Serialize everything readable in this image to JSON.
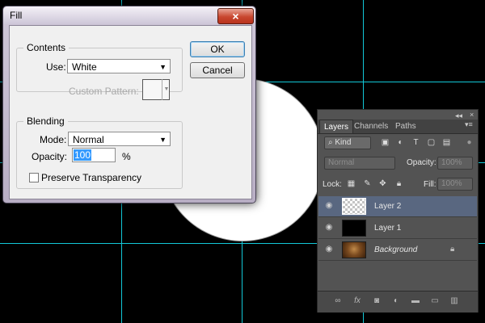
{
  "fill_dialog": {
    "title": "Fill",
    "close": "×",
    "contents_legend": "Contents",
    "use_label": "Use:",
    "use_value": "White",
    "custom_pattern_label": "Custom Pattern:",
    "blending_legend": "Blending",
    "mode_label": "Mode:",
    "mode_value": "Normal",
    "opacity_label": "Opacity:",
    "opacity_value": "100",
    "opacity_unit": "%",
    "preserve_label": "Preserve Transparency",
    "ok_label": "OK",
    "cancel_label": "Cancel"
  },
  "layers_panel": {
    "collapse": "◂◂",
    "close": "×",
    "menu": "▾≡",
    "tabs": [
      "Layers",
      "Channels",
      "Paths"
    ],
    "kind_value": "Kind",
    "blend_value": "Normal",
    "opacity_label": "Opacity:",
    "opacity_value": "100%",
    "lock_label": "Lock:",
    "fill_label": "Fill:",
    "fill_value": "100%",
    "layers": [
      {
        "name": "Layer 2",
        "selected": true
      },
      {
        "name": "Layer 1",
        "selected": false
      },
      {
        "name": "Background",
        "selected": false,
        "locked": true
      }
    ]
  },
  "icons": {
    "eye": "eye-icon",
    "lock": "lock-icon",
    "link": "link-icon",
    "fx": "fx-icon"
  },
  "colors": {
    "guide": "#12c8d8",
    "selected_layer": "#596780"
  }
}
